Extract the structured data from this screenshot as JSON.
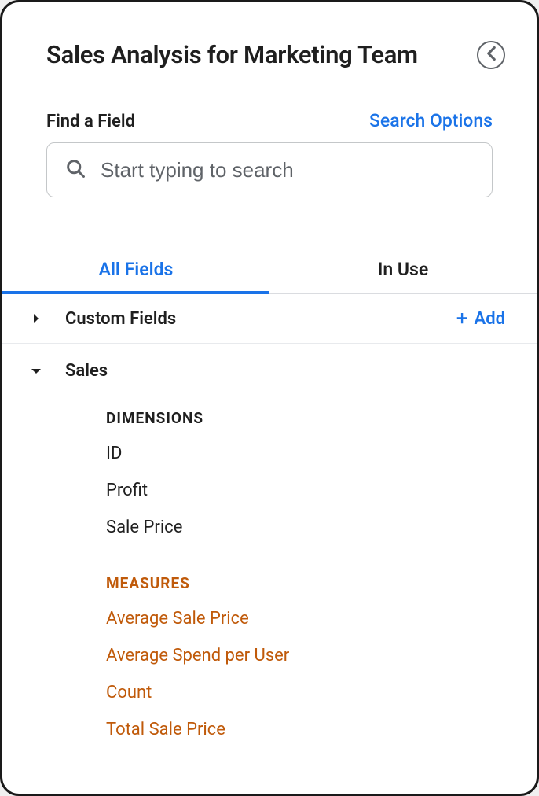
{
  "header": {
    "title": "Sales Analysis for Marketing Team"
  },
  "search": {
    "label": "Find a Field",
    "options_link": "Search Options",
    "placeholder": "Start typing to search"
  },
  "tabs": {
    "all_fields": "All Fields",
    "in_use": "In Use"
  },
  "custom_fields": {
    "label": "Custom Fields",
    "add_label": "Add"
  },
  "sales": {
    "label": "Sales",
    "dimensions_label": "DIMENSIONS",
    "measures_label": "MEASURES",
    "dimensions": {
      "0": "ID",
      "1": "Profit",
      "2": "Sale Price"
    },
    "measures": {
      "0": "Average Sale Price",
      "1": "Average Spend per User",
      "2": "Count",
      "3": "Total Sale Price"
    }
  }
}
